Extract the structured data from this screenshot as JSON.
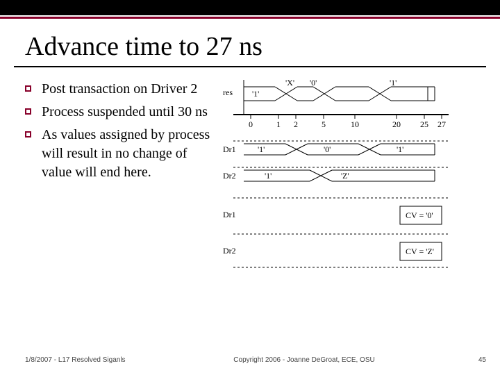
{
  "title": "Advance time to 27 ns",
  "bullets": [
    "Post transaction on Driver 2",
    "Process suspended until 30 ns",
    "As values assigned by process will result in no change of value will end here."
  ],
  "timing": {
    "signals": {
      "res": "res",
      "dr1": "Dr1",
      "dr2": "Dr2",
      "dr1b": "Dr1",
      "dr2b": "Dr2"
    },
    "ticks": [
      "0",
      "1",
      "2",
      "5",
      "10",
      "20",
      "25",
      "27"
    ],
    "values": {
      "res_a": "'1'",
      "res_b": "'X'",
      "res_c": "'0'",
      "res_d": "'1'",
      "dr1_a": "'1'",
      "dr1_b": "'0'",
      "dr1_c": "'1'",
      "dr2_a": "'1'",
      "dr2_b": "'Z'",
      "cv1": "CV = '0'",
      "cv2": "CV = 'Z'"
    }
  },
  "footer": {
    "left": "1/8/2007 - L17 Resolved Siganls",
    "center": "Copyright 2006 - Joanne DeGroat, ECE, OSU",
    "right": "45"
  }
}
